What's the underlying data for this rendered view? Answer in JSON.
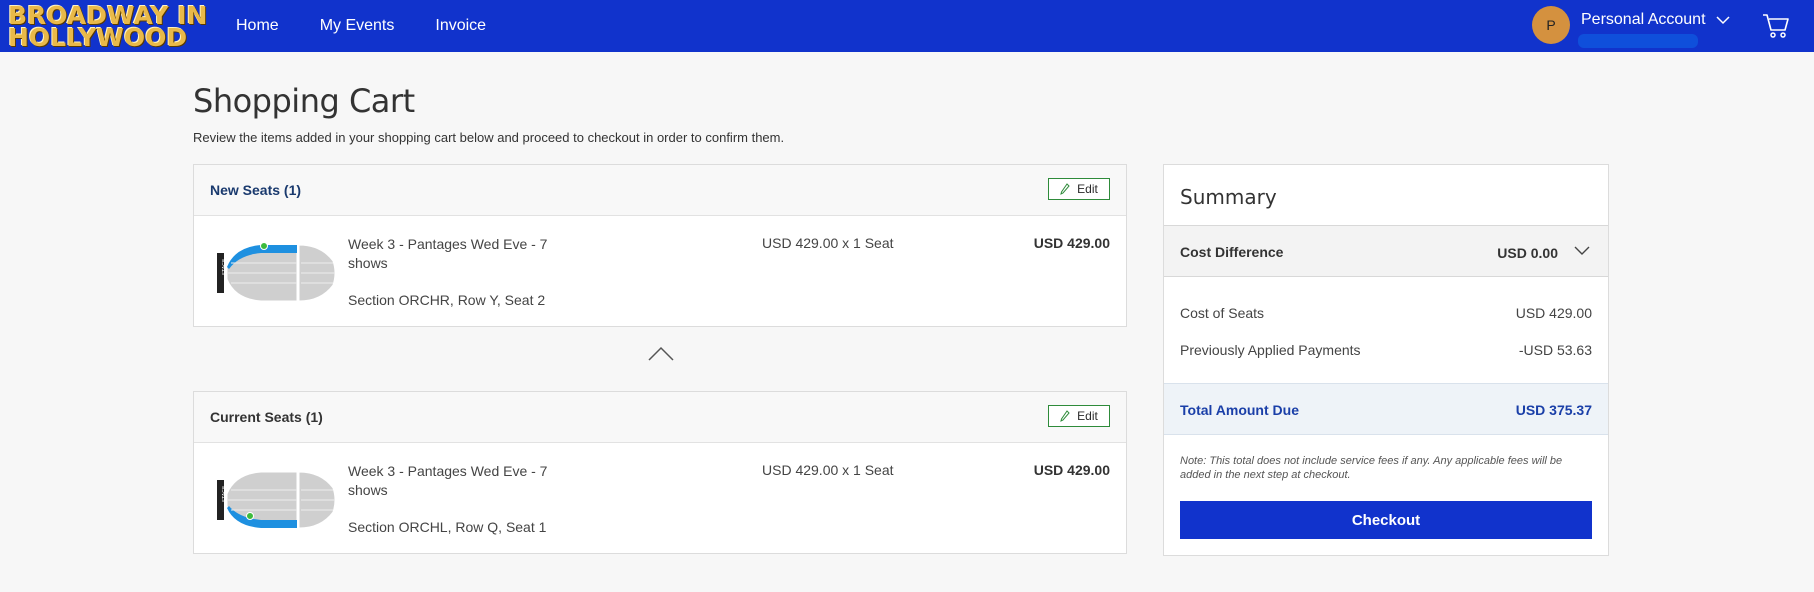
{
  "brand": {
    "line1": "BROADWAY IN",
    "line2": "HOLLYWOOD"
  },
  "nav": [
    {
      "label": "Home"
    },
    {
      "label": "My Events"
    },
    {
      "label": "Invoice"
    }
  ],
  "account": {
    "initial": "P",
    "label": "Personal Account"
  },
  "page": {
    "title": "Shopping Cart",
    "subtitle": "Review the items added in your shopping cart below and proceed to checkout in order to confirm them."
  },
  "new_seats": {
    "title": "New Seats (1)",
    "edit_label": "Edit",
    "item": {
      "event": "Week 3 - Pantages Wed Eve - 7 shows",
      "section": "Section ORCHR, Row Y, Seat 2",
      "qty": "USD 429.00 x 1 Seat",
      "total": "USD 429.00",
      "stage_label": "STAGE"
    }
  },
  "current_seats": {
    "title": "Current Seats (1)",
    "edit_label": "Edit",
    "item": {
      "event": "Week 3 - Pantages Wed Eve - 7 shows",
      "section": "Section ORCHL, Row Q, Seat 1",
      "qty": "USD 429.00 x 1 Seat",
      "total": "USD 429.00",
      "stage_label": "STAGE"
    }
  },
  "summary": {
    "title": "Summary",
    "cost_difference_label": "Cost Difference",
    "cost_difference_value": "USD 0.00",
    "cost_of_seats_label": "Cost of Seats",
    "cost_of_seats_value": "USD 429.00",
    "prev_payments_label": "Previously Applied Payments",
    "prev_payments_value": "-USD 53.63",
    "total_label": "Total Amount Due",
    "total_value": "USD 375.37",
    "note": "Note: This total does not include service fees if any. Any applicable fees will be added in the next step at checkout.",
    "checkout_label": "Checkout"
  },
  "colors": {
    "header": "#1133cc",
    "brand_gold": "#e9b949",
    "seat_highlight": "#1e90e0",
    "seat_marker": "#3dbb3d",
    "edit_border": "#2e8b3a",
    "total_text": "#1a3fa8"
  }
}
